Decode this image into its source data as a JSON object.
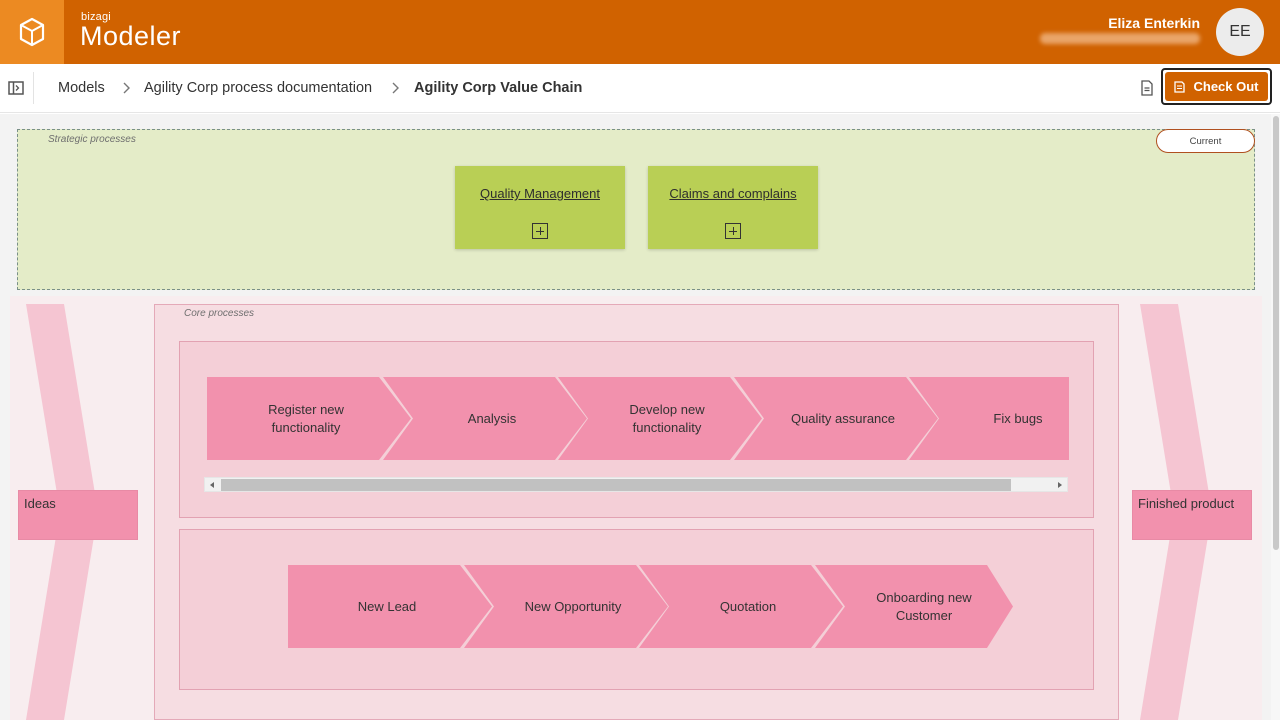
{
  "header": {
    "brand_small": "bizagi",
    "brand_title": "Modeler",
    "user_name": "Eliza Enterkin",
    "avatar_initials": "EE",
    "color": "#d06200",
    "logo_bg": "#ec8a22"
  },
  "toolbar": {
    "breadcrumbs": [
      "Models",
      "Agility Corp process documentation",
      "Agility Corp Value Chain"
    ],
    "checkout_label": "Check Out"
  },
  "diagram": {
    "strategic": {
      "label": "Strategic processes",
      "badge": "Current",
      "tasks": [
        "Quality Management",
        "Claims and complains"
      ]
    },
    "core": {
      "label": "Core processes",
      "lane1_steps": [
        "Register new functionality",
        "Analysis",
        "Develop new functionality",
        "Quality assurance",
        "Fix bugs"
      ],
      "lane2_steps": [
        "New Lead",
        "New Opportunity",
        "Quotation",
        "Onboarding new Customer"
      ]
    },
    "input_label": "Ideas",
    "output_label": "Finished product",
    "colors": {
      "strategic_bg": "#e4ecc8",
      "task_green": "#b9cf55",
      "chevron_pink": "#f291ad",
      "side_arrow_pink": "#f5c5d2"
    }
  }
}
